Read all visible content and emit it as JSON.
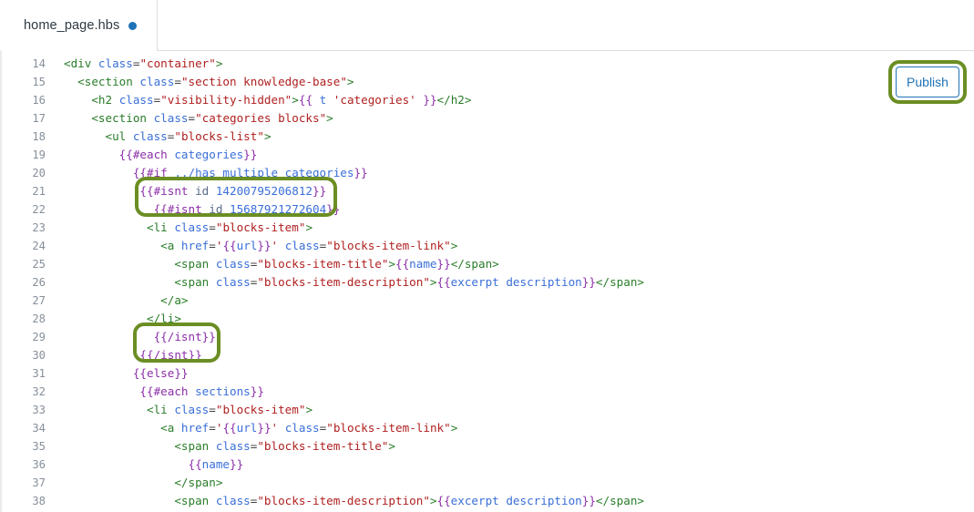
{
  "tab": {
    "filename": "home_page.hbs",
    "unsaved_indicator": "unsaved-dot",
    "dot_color": "#1f73b7"
  },
  "toolbar": {
    "publish_label": "Publish",
    "publish_border_color": "#1f73b7",
    "publish_text_color": "#1f73b7"
  },
  "annotations": {
    "highlight_color": "#6b8e23",
    "boxes": [
      {
        "name": "isnt-open-tags-highlight",
        "target": "lines 21-22"
      },
      {
        "name": "isnt-close-tags-highlight",
        "target": "lines 29-30"
      },
      {
        "name": "publish-button-highlight",
        "target": "Publish button"
      }
    ]
  },
  "editor": {
    "language": "handlebars",
    "first_visible_line": 14,
    "last_visible_line": 38,
    "colors": {
      "tag": "#2a7d2a",
      "attribute": "#3a6fd8",
      "string": "#b02020",
      "handlebars": "#8b2fa8",
      "variable": "#3a6fd8",
      "line_number": "#87909a",
      "text": "#333333"
    },
    "lines": [
      {
        "n": "14",
        "indent": 0,
        "tokens": [
          {
            "c": "t-tag",
            "t": "<div "
          },
          {
            "c": "t-attr",
            "t": "class"
          },
          {
            "c": "t-punct",
            "t": "="
          },
          {
            "c": "t-str",
            "t": "\"container\""
          },
          {
            "c": "t-tag",
            "t": ">"
          }
        ]
      },
      {
        "n": "15",
        "indent": 2,
        "tokens": [
          {
            "c": "t-tag",
            "t": "<section "
          },
          {
            "c": "t-attr",
            "t": "class"
          },
          {
            "c": "t-punct",
            "t": "="
          },
          {
            "c": "t-str",
            "t": "\"section knowledge-base\""
          },
          {
            "c": "t-tag",
            "t": ">"
          }
        ]
      },
      {
        "n": "16",
        "indent": 4,
        "tokens": [
          {
            "c": "t-tag",
            "t": "<h2 "
          },
          {
            "c": "t-attr",
            "t": "class"
          },
          {
            "c": "t-punct",
            "t": "="
          },
          {
            "c": "t-str",
            "t": "\"visibility-hidden\""
          },
          {
            "c": "t-tag",
            "t": ">"
          },
          {
            "c": "t-hbs",
            "t": "{{ "
          },
          {
            "c": "t-hbsvar",
            "t": "t "
          },
          {
            "c": "t-str",
            "t": "'categories'"
          },
          {
            "c": "t-hbs",
            "t": " }}"
          },
          {
            "c": "t-tag",
            "t": "</h2>"
          }
        ]
      },
      {
        "n": "17",
        "indent": 4,
        "tokens": [
          {
            "c": "t-tag",
            "t": "<section "
          },
          {
            "c": "t-attr",
            "t": "class"
          },
          {
            "c": "t-punct",
            "t": "="
          },
          {
            "c": "t-str",
            "t": "\"categories blocks\""
          },
          {
            "c": "t-tag",
            "t": ">"
          }
        ]
      },
      {
        "n": "18",
        "indent": 6,
        "tokens": [
          {
            "c": "t-tag",
            "t": "<ul "
          },
          {
            "c": "t-attr",
            "t": "class"
          },
          {
            "c": "t-punct",
            "t": "="
          },
          {
            "c": "t-str",
            "t": "\"blocks-list\""
          },
          {
            "c": "t-tag",
            "t": ">"
          }
        ]
      },
      {
        "n": "19",
        "indent": 8,
        "tokens": [
          {
            "c": "t-hbs",
            "t": "{{#each "
          },
          {
            "c": "t-hbsvar",
            "t": "categories"
          },
          {
            "c": "t-hbs",
            "t": "}}"
          }
        ]
      },
      {
        "n": "20",
        "indent": 10,
        "tokens": [
          {
            "c": "t-hbs",
            "t": "{{#if "
          },
          {
            "c": "t-hbsvar",
            "t": "../has_multiple_categories"
          },
          {
            "c": "t-hbs",
            "t": "}}"
          }
        ]
      },
      {
        "n": "21",
        "indent": 11,
        "tokens": [
          {
            "c": "t-hbs",
            "t": "{{#isnt "
          },
          {
            "c": "t-helper",
            "t": "id "
          },
          {
            "c": "t-num",
            "t": "14200795206812"
          },
          {
            "c": "t-hbs",
            "t": "}}"
          }
        ]
      },
      {
        "n": "22",
        "indent": 13,
        "tokens": [
          {
            "c": "t-hbs",
            "t": "{{#isnt "
          },
          {
            "c": "t-helper",
            "t": "id "
          },
          {
            "c": "t-num",
            "t": "15687921272604"
          },
          {
            "c": "t-hbs",
            "t": "}}"
          }
        ]
      },
      {
        "n": "23",
        "indent": 12,
        "tokens": [
          {
            "c": "t-tag",
            "t": "<li "
          },
          {
            "c": "t-attr",
            "t": "class"
          },
          {
            "c": "t-punct",
            "t": "="
          },
          {
            "c": "t-str",
            "t": "\"blocks-item\""
          },
          {
            "c": "t-tag",
            "t": ">"
          }
        ]
      },
      {
        "n": "24",
        "indent": 14,
        "tokens": [
          {
            "c": "t-tag",
            "t": "<a "
          },
          {
            "c": "t-attr",
            "t": "href"
          },
          {
            "c": "t-punct",
            "t": "="
          },
          {
            "c": "t-str",
            "t": "'"
          },
          {
            "c": "t-hbs",
            "t": "{{"
          },
          {
            "c": "t-hbsvar",
            "t": "url"
          },
          {
            "c": "t-hbs",
            "t": "}}"
          },
          {
            "c": "t-str",
            "t": "'"
          },
          {
            "c": "t-plain",
            "t": " "
          },
          {
            "c": "t-attr",
            "t": "class"
          },
          {
            "c": "t-punct",
            "t": "="
          },
          {
            "c": "t-str",
            "t": "\"blocks-item-link\""
          },
          {
            "c": "t-tag",
            "t": ">"
          }
        ]
      },
      {
        "n": "25",
        "indent": 16,
        "tokens": [
          {
            "c": "t-tag",
            "t": "<span "
          },
          {
            "c": "t-attr",
            "t": "class"
          },
          {
            "c": "t-punct",
            "t": "="
          },
          {
            "c": "t-str",
            "t": "\"blocks-item-title\""
          },
          {
            "c": "t-tag",
            "t": ">"
          },
          {
            "c": "t-hbs",
            "t": "{{"
          },
          {
            "c": "t-hbsvar",
            "t": "name"
          },
          {
            "c": "t-hbs",
            "t": "}}"
          },
          {
            "c": "t-tag",
            "t": "</span>"
          }
        ]
      },
      {
        "n": "26",
        "indent": 16,
        "tokens": [
          {
            "c": "t-tag",
            "t": "<span "
          },
          {
            "c": "t-attr",
            "t": "class"
          },
          {
            "c": "t-punct",
            "t": "="
          },
          {
            "c": "t-str",
            "t": "\"blocks-item-description\""
          },
          {
            "c": "t-tag",
            "t": ">"
          },
          {
            "c": "t-hbs",
            "t": "{{"
          },
          {
            "c": "t-hbsvar",
            "t": "excerpt description"
          },
          {
            "c": "t-hbs",
            "t": "}}"
          },
          {
            "c": "t-tag",
            "t": "</span>"
          }
        ]
      },
      {
        "n": "27",
        "indent": 14,
        "tokens": [
          {
            "c": "t-tag",
            "t": "</a>"
          }
        ]
      },
      {
        "n": "28",
        "indent": 12,
        "tokens": [
          {
            "c": "t-tag",
            "t": "</li>"
          }
        ]
      },
      {
        "n": "29",
        "indent": 13,
        "tokens": [
          {
            "c": "t-hbs",
            "t": "{{/isnt}}"
          }
        ]
      },
      {
        "n": "30",
        "indent": 11,
        "tokens": [
          {
            "c": "t-hbs",
            "t": "{{/isnt}}"
          }
        ]
      },
      {
        "n": "31",
        "indent": 10,
        "tokens": [
          {
            "c": "t-hbs",
            "t": "{{else}}"
          }
        ]
      },
      {
        "n": "32",
        "indent": 11,
        "tokens": [
          {
            "c": "t-hbs",
            "t": "{{#each "
          },
          {
            "c": "t-hbsvar",
            "t": "sections"
          },
          {
            "c": "t-hbs",
            "t": "}}"
          }
        ]
      },
      {
        "n": "33",
        "indent": 12,
        "tokens": [
          {
            "c": "t-tag",
            "t": "<li "
          },
          {
            "c": "t-attr",
            "t": "class"
          },
          {
            "c": "t-punct",
            "t": "="
          },
          {
            "c": "t-str",
            "t": "\"blocks-item\""
          },
          {
            "c": "t-tag",
            "t": ">"
          }
        ]
      },
      {
        "n": "34",
        "indent": 14,
        "tokens": [
          {
            "c": "t-tag",
            "t": "<a "
          },
          {
            "c": "t-attr",
            "t": "href"
          },
          {
            "c": "t-punct",
            "t": "="
          },
          {
            "c": "t-str",
            "t": "'"
          },
          {
            "c": "t-hbs",
            "t": "{{"
          },
          {
            "c": "t-hbsvar",
            "t": "url"
          },
          {
            "c": "t-hbs",
            "t": "}}"
          },
          {
            "c": "t-str",
            "t": "'"
          },
          {
            "c": "t-plain",
            "t": " "
          },
          {
            "c": "t-attr",
            "t": "class"
          },
          {
            "c": "t-punct",
            "t": "="
          },
          {
            "c": "t-str",
            "t": "\"blocks-item-link\""
          },
          {
            "c": "t-tag",
            "t": ">"
          }
        ]
      },
      {
        "n": "35",
        "indent": 16,
        "tokens": [
          {
            "c": "t-tag",
            "t": "<span "
          },
          {
            "c": "t-attr",
            "t": "class"
          },
          {
            "c": "t-punct",
            "t": "="
          },
          {
            "c": "t-str",
            "t": "\"blocks-item-title\""
          },
          {
            "c": "t-tag",
            "t": ">"
          }
        ]
      },
      {
        "n": "36",
        "indent": 18,
        "tokens": [
          {
            "c": "t-hbs",
            "t": "{{"
          },
          {
            "c": "t-hbsvar",
            "t": "name"
          },
          {
            "c": "t-hbs",
            "t": "}}"
          }
        ]
      },
      {
        "n": "37",
        "indent": 16,
        "tokens": [
          {
            "c": "t-tag",
            "t": "</span>"
          }
        ]
      },
      {
        "n": "38",
        "indent": 16,
        "tokens": [
          {
            "c": "t-tag",
            "t": "<span "
          },
          {
            "c": "t-attr",
            "t": "class"
          },
          {
            "c": "t-punct",
            "t": "="
          },
          {
            "c": "t-str",
            "t": "\"blocks-item-description\""
          },
          {
            "c": "t-tag",
            "t": ">"
          },
          {
            "c": "t-hbs",
            "t": "{{"
          },
          {
            "c": "t-hbsvar",
            "t": "excerpt description"
          },
          {
            "c": "t-hbs",
            "t": "}}"
          },
          {
            "c": "t-tag",
            "t": "</span>"
          }
        ]
      }
    ]
  }
}
